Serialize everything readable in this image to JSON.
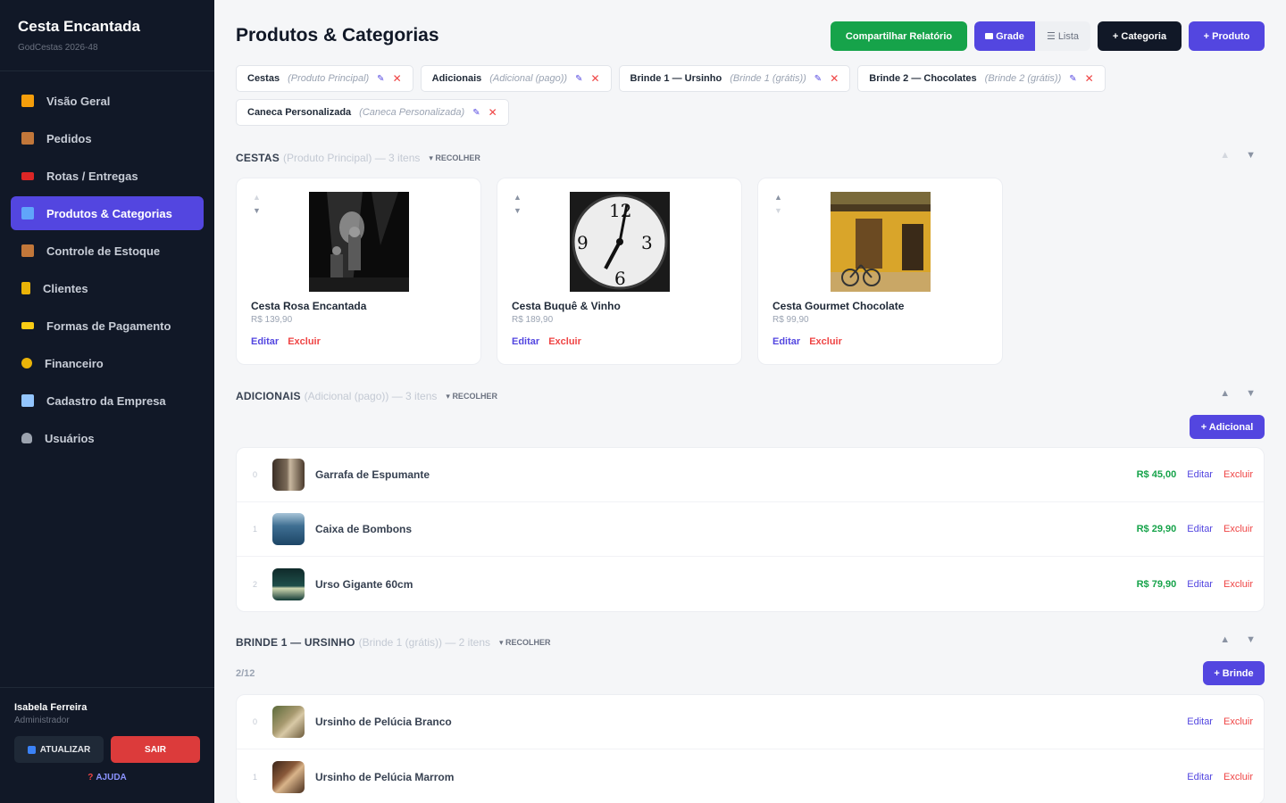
{
  "brand": {
    "title": "Cesta Encantada",
    "subtitle": "GodCestas 2026-48"
  },
  "nav": [
    {
      "label": "Visão Geral",
      "icon": "chart-icon",
      "color": "#f59e0b",
      "glyph": "▮"
    },
    {
      "label": "Pedidos",
      "icon": "box-icon",
      "color": "#d97706",
      "glyph": "▮"
    },
    {
      "label": "Rotas / Entregas",
      "icon": "truck-icon",
      "color": "#ef4444",
      "glyph": "▮"
    },
    {
      "label": "Produtos & Categorias",
      "icon": "shelf-icon",
      "color": "#60a5fa",
      "glyph": "▮"
    },
    {
      "label": "Controle de Estoque",
      "icon": "box-icon",
      "color": "#d97706",
      "glyph": "▮"
    },
    {
      "label": "Clientes",
      "icon": "people-icon",
      "color": "#f59e0b",
      "glyph": "▮"
    },
    {
      "label": "Formas de Pagamento",
      "icon": "card-icon",
      "color": "#facc15",
      "glyph": "▮"
    },
    {
      "label": "Financeiro",
      "icon": "money-bag-icon",
      "color": "#eab308",
      "glyph": "●"
    },
    {
      "label": "Cadastro da Empresa",
      "icon": "building-icon",
      "color": "#93c5fd",
      "glyph": "▮"
    },
    {
      "label": "Usuários",
      "icon": "user-icon",
      "color": "#9ca3af",
      "glyph": "●"
    }
  ],
  "user": {
    "name": "Isabela Ferreira",
    "role": "Administrador"
  },
  "footer": {
    "update_label": "ATUALIZAR",
    "logout_label": "SAIR",
    "help_label": "AJUDA"
  },
  "page": {
    "title": "Produtos & Categorias"
  },
  "toolbar": {
    "share_label": "Compartilhar Relatório",
    "grid_label": "Grade",
    "list_label": "Lista",
    "add_category_label": "+ Categoria",
    "add_product_label": "+ Produto"
  },
  "chips": [
    {
      "name": "Cestas",
      "role": "(Produto Principal)"
    },
    {
      "name": "Adicionais",
      "role": "(Adicional (pago))"
    },
    {
      "name": "Brinde 1 — Ursinho",
      "role": "(Brinde 1 (grátis))"
    },
    {
      "name": "Brinde 2 — Chocolates",
      "role": "(Brinde 2 (grátis))"
    },
    {
      "name": "Caneca Personalizada",
      "role": "(Caneca Personalizada)"
    }
  ],
  "sections": {
    "cestas": {
      "title": "CESTAS",
      "meta": "(Produto Principal) — 3 itens",
      "collapse": "RECOLHER"
    },
    "adicionais": {
      "title": "ADICIONAIS",
      "meta": "(Adicional (pago)) — 3 itens",
      "collapse": "RECOLHER",
      "add_label": "+ Adicional"
    },
    "brinde1": {
      "title": "BRINDE 1 — URSINHO",
      "meta": "(Brinde 1 (grátis)) — 2 itens",
      "collapse": "RECOLHER",
      "add_label": "+ Brinde",
      "count": "2/12"
    }
  },
  "cards": [
    {
      "name": "Cesta Rosa Encantada",
      "price": "R$ 139,90",
      "image": "concert-photo"
    },
    {
      "name": "Cesta Buquê & Vinho",
      "price": "R$ 189,90",
      "image": "clock-photo"
    },
    {
      "name": "Cesta Gourmet Chocolate",
      "price": "R$ 99,90",
      "image": "yellow-house-photo"
    }
  ],
  "actions": {
    "edit": "Editar",
    "delete": "Excluir"
  },
  "adicionais": [
    {
      "idx": "0",
      "name": "Garrafa de Espumante",
      "price": "R$ 45,00"
    },
    {
      "idx": "1",
      "name": "Caixa de Bombons",
      "price": "R$ 29,90"
    },
    {
      "idx": "2",
      "name": "Urso Gigante 60cm",
      "price": "R$ 79,90"
    }
  ],
  "brinde1": [
    {
      "idx": "0",
      "name": "Ursinho de Pelúcia Branco"
    },
    {
      "idx": "1",
      "name": "Ursinho de Pelúcia Marrom"
    }
  ],
  "colors": {
    "accent": "#5346e0",
    "success": "#16a34a",
    "danger": "#ef4444",
    "sidebar": "#111827"
  }
}
